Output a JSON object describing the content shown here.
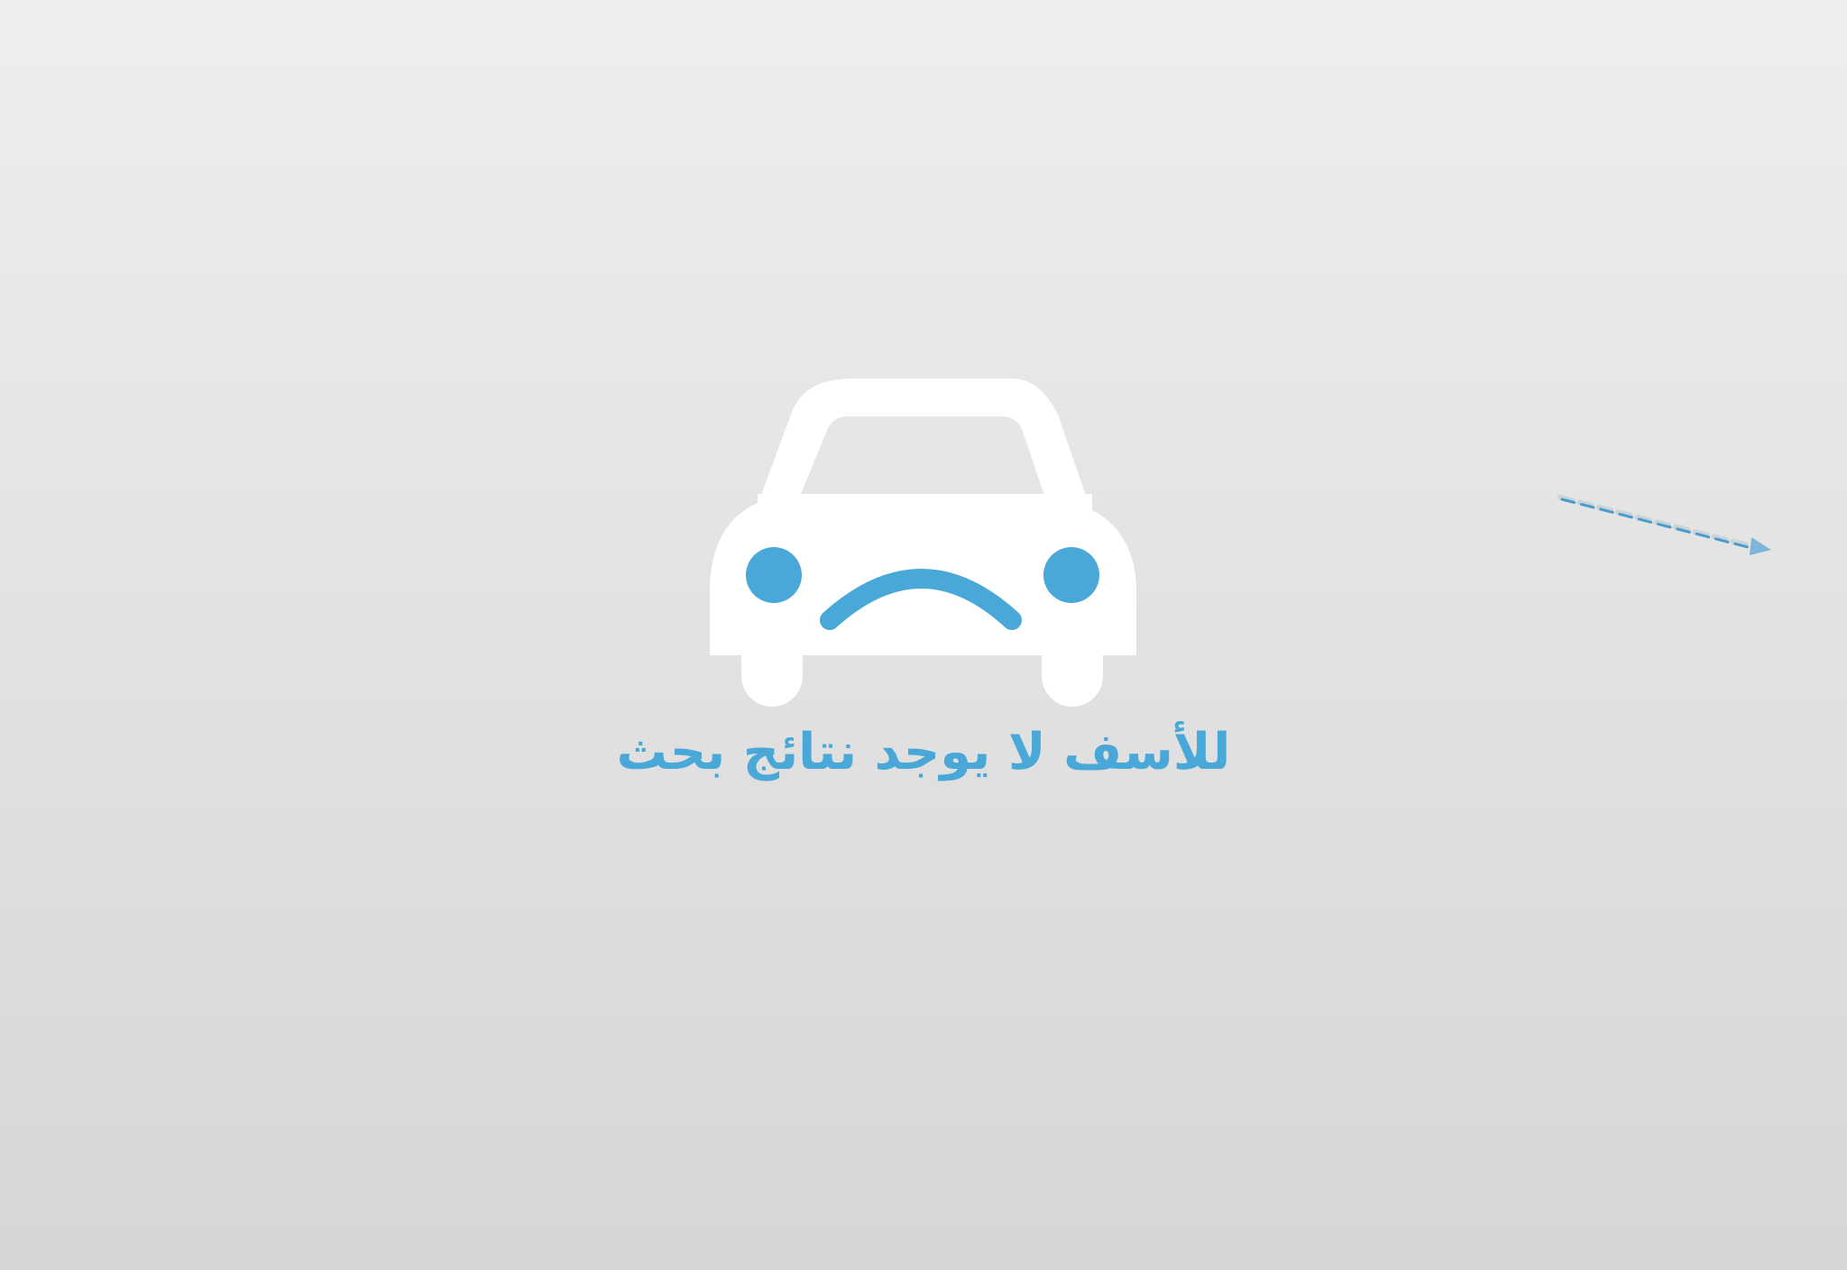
{
  "empty_state": {
    "message": "للأسف لا يوجد نتائج بحث",
    "icon": "sad-car-icon",
    "hint_icon": "dashed-arrow-icon"
  },
  "colors": {
    "accent": "#4aa8d8",
    "car_body": "#ffffff",
    "background_top": "#eeeeee",
    "background_bottom": "#d6d6d6"
  }
}
